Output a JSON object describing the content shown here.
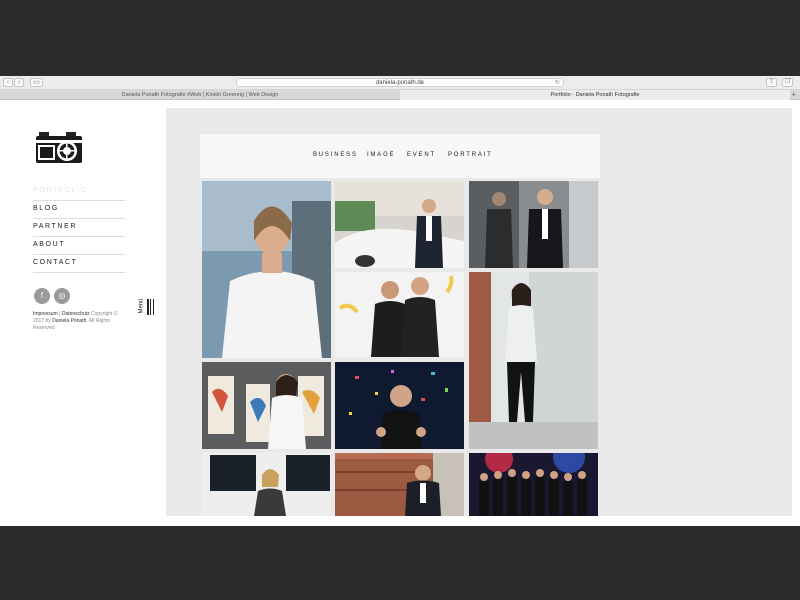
{
  "browser": {
    "url": "daniela-ponath.de",
    "tabs": [
      {
        "label": "Daniela Ponath Fotografie #Web | Kirstin Greenrig | Web Design"
      },
      {
        "label": "Portfolio - Daniela Ponath Fotografie"
      }
    ]
  },
  "sidebar": {
    "menu": [
      {
        "label": "PORTFOLIO"
      },
      {
        "label": "BLOG"
      },
      {
        "label": "PARTNER"
      },
      {
        "label": "ABOUT"
      },
      {
        "label": "CONTACT"
      }
    ],
    "social": [
      {
        "icon": "facebook-icon",
        "glyph": "f"
      },
      {
        "icon": "pinterest-icon",
        "glyph": "◎"
      }
    ],
    "footer": {
      "impressum": "Impressum",
      "separator": "|",
      "datenschutz": "Datenschutz",
      "copyright": "Copyright © 2017 by",
      "owner": "Daniela Ponath",
      "rights": ". All Rights Reserved"
    },
    "menu_toggle": "Menü"
  },
  "portfolio_nav": [
    {
      "label": "BUSINESS"
    },
    {
      "label": "IMAGE"
    },
    {
      "label": "EVENT"
    },
    {
      "label": "PORTRAIT"
    }
  ],
  "colors": {
    "page_bg": "#e9e9e9",
    "nav_bg": "#f7f7f7",
    "text": "#222222"
  }
}
